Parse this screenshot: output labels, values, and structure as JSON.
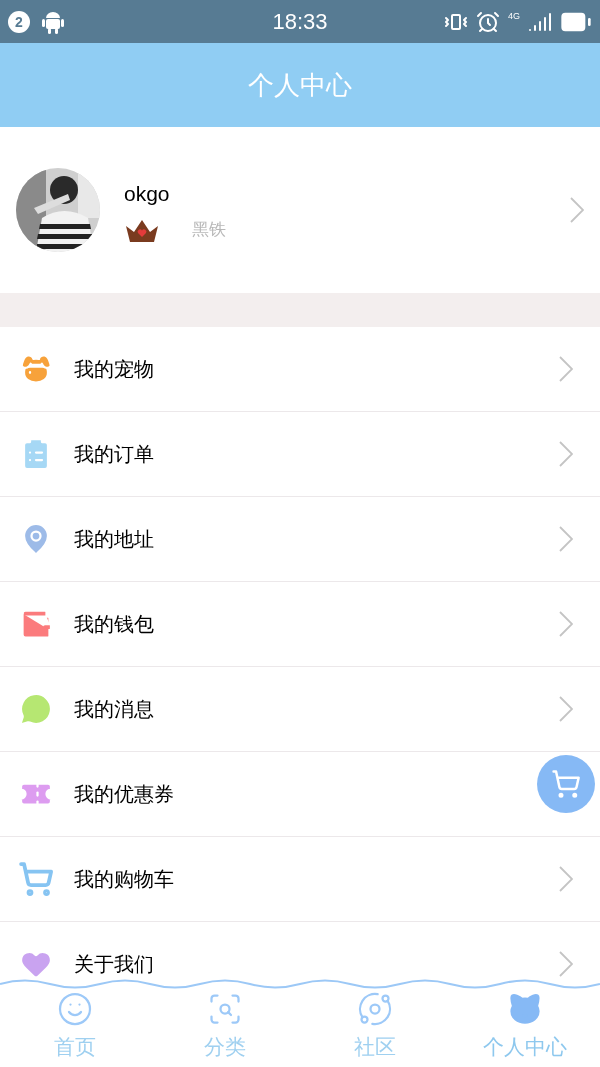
{
  "status_bar": {
    "notification_count": "2",
    "time": "18:33",
    "network": "4G"
  },
  "header": {
    "title": "个人中心"
  },
  "profile": {
    "username": "okgo",
    "level": "黑铁"
  },
  "menu": [
    {
      "label": "我的宠物"
    },
    {
      "label": "我的订单"
    },
    {
      "label": "我的地址"
    },
    {
      "label": "我的钱包"
    },
    {
      "label": "我的消息"
    },
    {
      "label": "我的优惠券"
    },
    {
      "label": "我的购物车"
    },
    {
      "label": "关于我们"
    }
  ],
  "tabs": [
    {
      "label": "首页",
      "selected": false
    },
    {
      "label": "分类",
      "selected": false
    },
    {
      "label": "社区",
      "selected": false
    },
    {
      "label": "个人中心",
      "selected": true
    }
  ]
}
